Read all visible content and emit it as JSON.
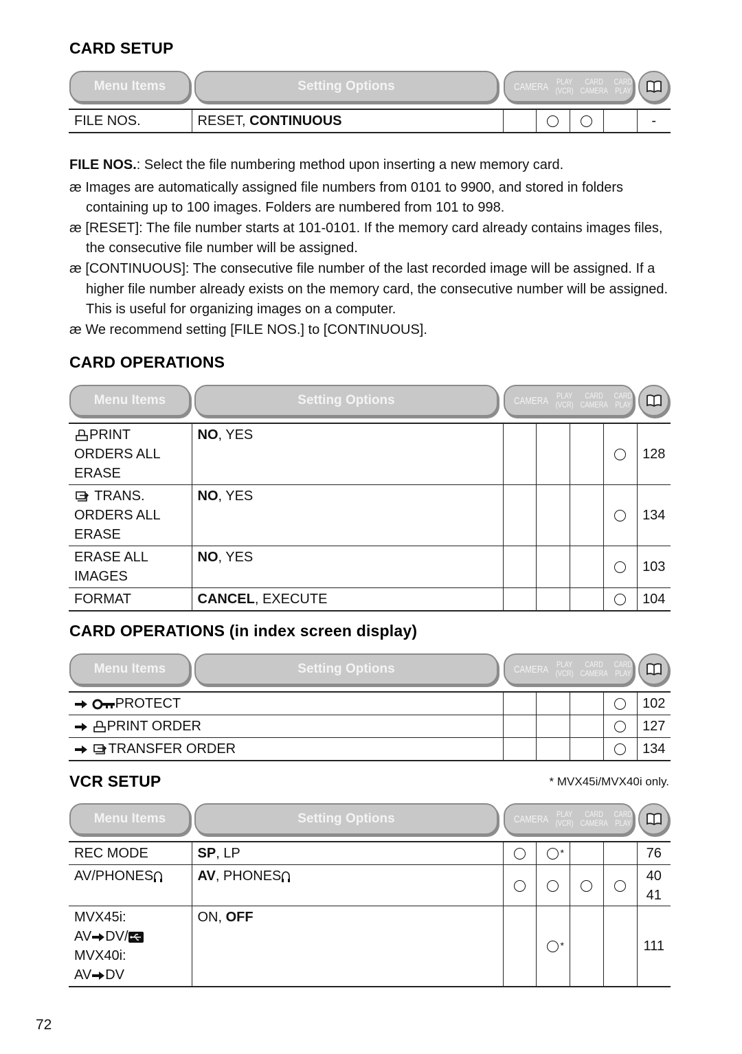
{
  "page_number": "72",
  "header_bar": {
    "menu_items": "Menu Items",
    "setting_options": "Setting Options",
    "modes": [
      {
        "line1": "CAMERA",
        "line2": ""
      },
      {
        "line1": "PLAY",
        "line2": "(VCR)"
      },
      {
        "line1": "CARD",
        "line2": "CAMERA"
      },
      {
        "line1": "CARD",
        "line2": "PLAY"
      }
    ],
    "reference_icon": "book-icon"
  },
  "card_setup": {
    "title": "CARD SETUP",
    "rows": [
      {
        "item": "FILE NOS.",
        "options_plain_before": "RESET, ",
        "options_bold": "CONTINUOUS",
        "options_plain_after": "",
        "modes": [
          "",
          "o",
          "o",
          ""
        ],
        "page": "-"
      }
    ],
    "description": {
      "lead_bold": "FILE NOS.",
      "lead_text": ": Select the file numbering method upon inserting a new memory card.",
      "bullet_symbol": "æ",
      "bullets": [
        "Images are automatically assigned file numbers from 0101 to 9900, and stored in folders containing up to 100 images. Folders are numbered from 101 to 998.",
        "[RESET]: The file number starts at 101-0101. If the memory card already contains images files, the consecutive file number will be assigned.",
        "[CONTINUOUS]: The consecutive file number of the last recorded image will be assigned. If a higher file number already exists on the memory card, the consecutive number will be assigned. This is useful for organizing images on a computer.",
        "We recommend setting [FILE NOS.] to [CONTINUOUS]."
      ]
    }
  },
  "card_operations": {
    "title": "CARD OPERATIONS",
    "rows": [
      {
        "icon": "print-order-icon",
        "item_lines": [
          "PRINT",
          "ORDERS ALL",
          "ERASE"
        ],
        "options_bold": "NO",
        "options_rest": ", YES",
        "modes": [
          "",
          "",
          "",
          "o"
        ],
        "page": "128"
      },
      {
        "icon": "transfer-order-icon",
        "item_lines": [
          "TRANS.",
          "ORDERS ALL",
          "ERASE"
        ],
        "options_bold": "NO",
        "options_rest": ", YES",
        "modes": [
          "",
          "",
          "",
          "o"
        ],
        "page": "134"
      },
      {
        "icon": "",
        "item_lines": [
          "ERASE ALL",
          "IMAGES"
        ],
        "options_bold": "NO",
        "options_rest": ", YES",
        "modes": [
          "",
          "",
          "",
          "o"
        ],
        "page": "103"
      },
      {
        "icon": "",
        "item_lines": [
          "FORMAT"
        ],
        "options_bold": "CANCEL",
        "options_rest": ", EXECUTE",
        "modes": [
          "",
          "",
          "",
          "o"
        ],
        "page": "104"
      }
    ]
  },
  "card_operations_index": {
    "title": "CARD OPERATIONS (in index screen display)",
    "rows": [
      {
        "icon": "protect-key-icon",
        "label": "PROTECT",
        "modes": [
          "",
          "",
          "",
          "o"
        ],
        "page": "102"
      },
      {
        "icon": "print-order-icon",
        "label": "PRINT ORDER",
        "modes": [
          "",
          "",
          "",
          "o"
        ],
        "page": "127"
      },
      {
        "icon": "transfer-order-icon",
        "label": "TRANSFER ORDER",
        "modes": [
          "",
          "",
          "",
          "o"
        ],
        "page": "134"
      }
    ]
  },
  "vcr_setup": {
    "title": "VCR SETUP",
    "footnote": "* MVX45i/MVX40i only.",
    "rows": [
      {
        "item_lines": [
          "REC MODE"
        ],
        "options": [
          {
            "t": "SP",
            "b": true
          },
          {
            "t": ", LP",
            "b": false
          }
        ],
        "modes": [
          "o",
          "o*",
          "",
          ""
        ],
        "page_lines": [
          "76"
        ]
      },
      {
        "item_lines": [
          "AV/PHONES"
        ],
        "options": [
          {
            "t": "AV",
            "b": true
          },
          {
            "t": ", PHONES",
            "b": false
          }
        ],
        "modes": [
          "o",
          "o",
          "o",
          "o"
        ],
        "page_lines": [
          "40",
          "41"
        ]
      },
      {
        "item_lines": [
          "MVX45i:",
          "AV",
          "DV/",
          "MVX40i:",
          "AV",
          "DV"
        ],
        "options": [
          {
            "t": "ON, ",
            "b": false
          },
          {
            "t": "OFF",
            "b": true
          }
        ],
        "modes": [
          "",
          "o*",
          "",
          ""
        ],
        "page_lines": [
          "111"
        ]
      }
    ]
  }
}
